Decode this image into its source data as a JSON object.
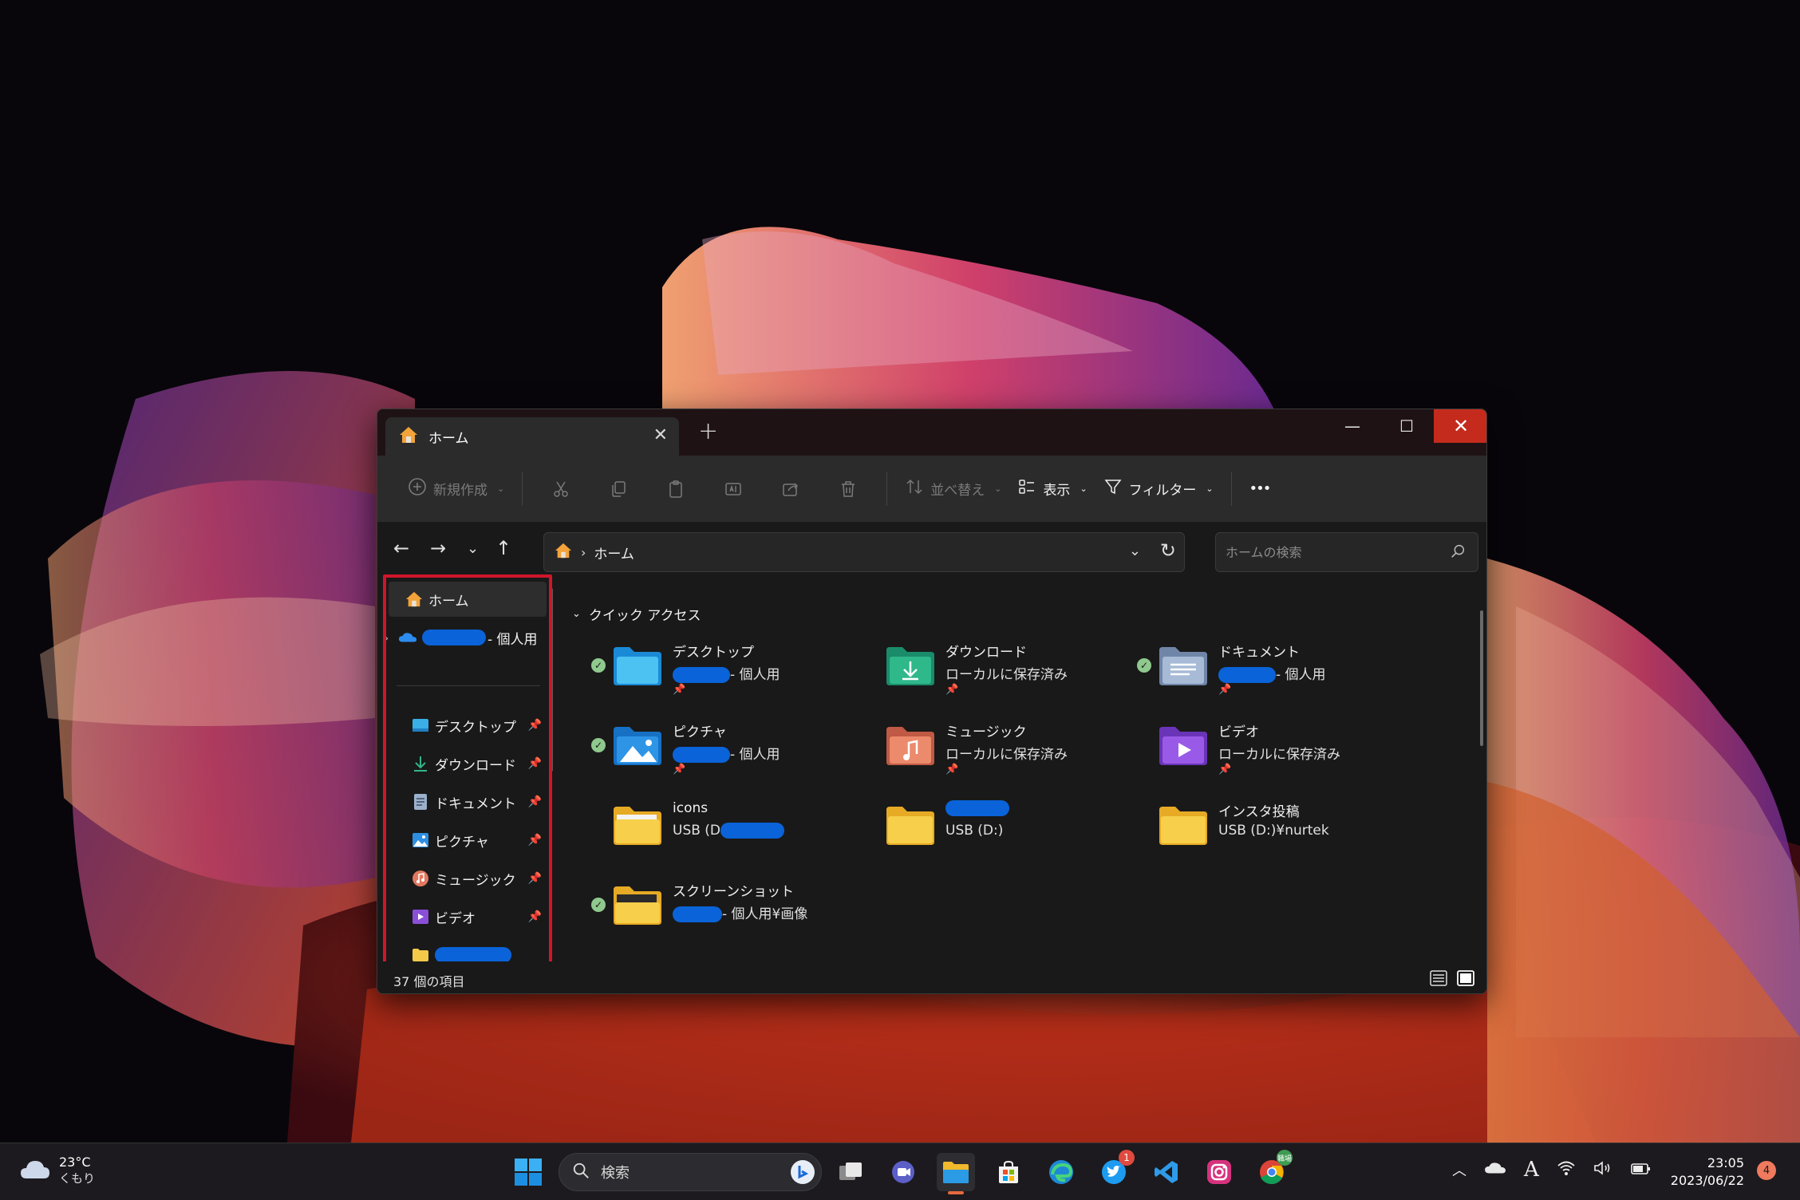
{
  "window": {
    "tab_title": "ホーム",
    "controls": {
      "minimize": "—",
      "maximize": "☐",
      "close": "✕"
    }
  },
  "toolbar": {
    "new_label": "新規作成",
    "sort_label": "並べ替え",
    "view_label": "表示",
    "filter_label": "フィルター",
    "more_label": "•••"
  },
  "address": {
    "path": "ホーム",
    "search_placeholder": "ホームの検索"
  },
  "nav": {
    "home": "ホーム",
    "onedrive": "- 個人用",
    "items": [
      {
        "label": "デスクトップ",
        "icon": "desktop-icon"
      },
      {
        "label": "ダウンロード",
        "icon": "download-icon"
      },
      {
        "label": "ドキュメント",
        "icon": "document-icon"
      },
      {
        "label": "ピクチャ",
        "icon": "pictures-icon"
      },
      {
        "label": "ミュージック",
        "icon": "music-icon"
      },
      {
        "label": "ビデオ",
        "icon": "video-icon"
      }
    ]
  },
  "quick_access": {
    "header": "クイック アクセス",
    "items": [
      {
        "name": "デスクトップ",
        "sub": "- 個人用"
      },
      {
        "name": "ダウンロード",
        "sub": "ローカルに保存済み"
      },
      {
        "name": "ドキュメント",
        "sub": "- 個人用"
      },
      {
        "name": "ピクチャ",
        "sub": "- 個人用"
      },
      {
        "name": "ミュージック",
        "sub": "ローカルに保存済み"
      },
      {
        "name": "ビデオ",
        "sub": "ローカルに保存済み"
      },
      {
        "name": "icons",
        "sub": "USB (D:"
      },
      {
        "name": "",
        "sub": "USB (D:)"
      },
      {
        "name": "インスタ投稿",
        "sub": "USB (D:)¥nurtek"
      },
      {
        "name": "スクリーンショット",
        "sub": "- 個人用¥画像"
      }
    ]
  },
  "status": {
    "count": "37 個の項目"
  },
  "taskbar": {
    "weather_temp": "23°C",
    "weather_cond": "くもり",
    "search_label": "検索",
    "twitter_badge": "1",
    "chrome_badge": "職場",
    "clock_time": "23:05",
    "clock_date": "2023/06/22",
    "notification_count": "4",
    "ime_label": "A"
  }
}
